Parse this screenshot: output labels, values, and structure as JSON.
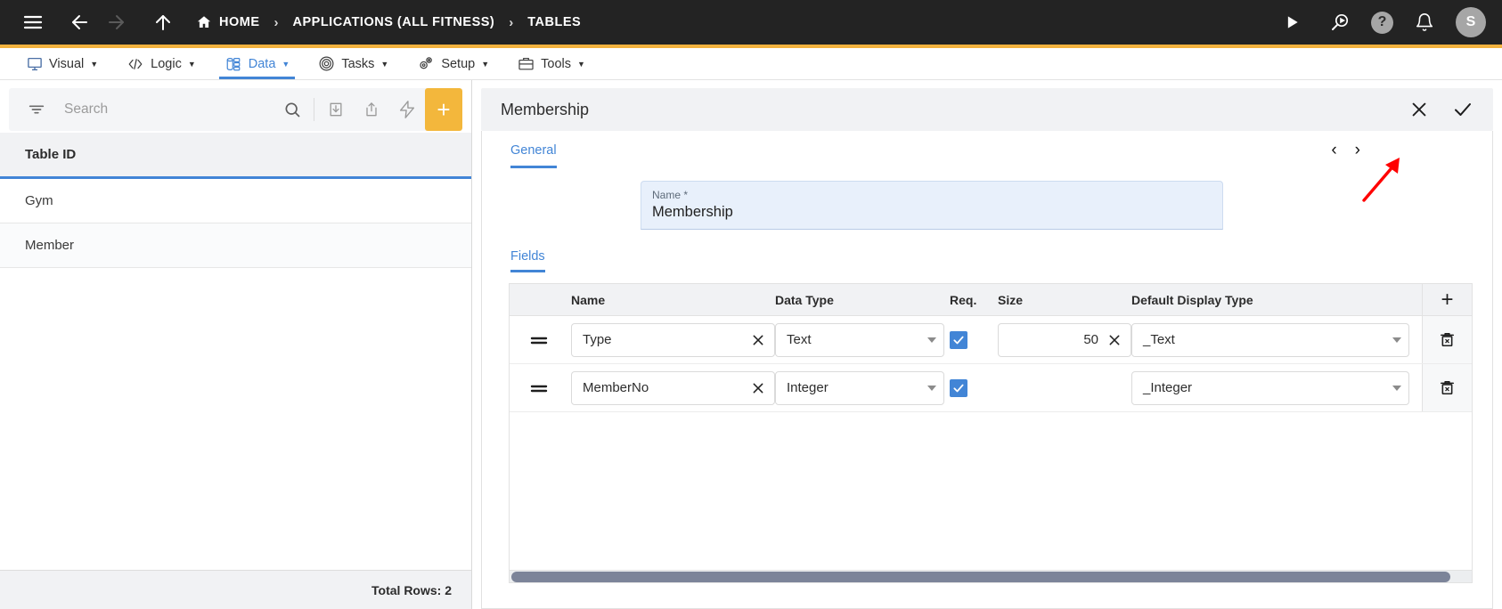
{
  "topbar": {
    "menu_icon": "hamburger-icon",
    "back_icon": "arrow-left-icon",
    "forward_icon": "arrow-right-icon",
    "up_icon": "arrow-up-icon",
    "breadcrumbs": [
      {
        "label": "HOME",
        "icon": "home-icon"
      },
      {
        "label": "APPLICATIONS (ALL FITNESS)"
      },
      {
        "label": "TABLES"
      }
    ],
    "separator": "›",
    "actions": [
      {
        "name": "run-icon",
        "glyph": "▶"
      },
      {
        "name": "search-preview-icon"
      },
      {
        "name": "help-icon",
        "glyph": "?"
      },
      {
        "name": "notifications-bell-icon"
      }
    ],
    "avatar_initial": "S",
    "accent_color": "#f2b23e",
    "background_color": "#232323"
  },
  "menubar": {
    "items": [
      {
        "label": "Visual",
        "icon": "monitor-icon",
        "active": false
      },
      {
        "label": "Logic",
        "icon": "code-brackets-icon",
        "active": false
      },
      {
        "label": "Data",
        "icon": "database-icon",
        "active": true
      },
      {
        "label": "Tasks",
        "icon": "target-icon",
        "active": false
      },
      {
        "label": "Setup",
        "icon": "gears-icon",
        "active": false
      },
      {
        "label": "Tools",
        "icon": "toolbox-icon",
        "active": false
      }
    ],
    "caret": "▼",
    "active_color": "#4285d6"
  },
  "sidebar": {
    "search": {
      "placeholder": "Search",
      "value": "",
      "filter_icon": "filter-icon",
      "search_icon": "search-icon"
    },
    "toolbar_buttons": [
      {
        "name": "import-icon"
      },
      {
        "name": "export-icon"
      },
      {
        "name": "quick-action-icon"
      },
      {
        "name": "add-table-button",
        "glyph": "+"
      }
    ],
    "column_header": "Table ID",
    "rows": [
      {
        "label": "Gym"
      },
      {
        "label": "Member"
      }
    ],
    "footer": "Total Rows: 2"
  },
  "detail": {
    "title": "Membership",
    "header_actions": [
      {
        "name": "close-panel-button",
        "icon": "close-x-icon"
      },
      {
        "name": "save-panel-button",
        "icon": "check-icon"
      }
    ],
    "tabs": [
      {
        "label": "General",
        "active": true
      }
    ],
    "pager": {
      "prev": "‹",
      "next": "›"
    },
    "name_field": {
      "label": "Name *",
      "value": "Membership"
    },
    "sub_tabs": [
      {
        "label": "Fields",
        "active": true
      }
    ],
    "fields_table": {
      "columns": [
        "Name",
        "Data Type",
        "Req.",
        "Size",
        "Default Display Type"
      ],
      "add_row_glyph": "+",
      "rows": [
        {
          "handle_icon": "drag-handle-icon",
          "name": "Type",
          "data_type": "Text",
          "required": true,
          "size": "50",
          "default_display_type": "_Text",
          "delete_icon": "delete-row-icon"
        },
        {
          "handle_icon": "drag-handle-icon",
          "name": "MemberNo",
          "data_type": "Integer",
          "required": true,
          "size": "",
          "default_display_type": "_Integer",
          "delete_icon": "delete-row-icon"
        }
      ]
    },
    "scrollbar": {
      "name": "horizontal-scrollbar"
    }
  },
  "annotation": {
    "arrow_color": "#ff0000",
    "target": "next-record-button"
  }
}
